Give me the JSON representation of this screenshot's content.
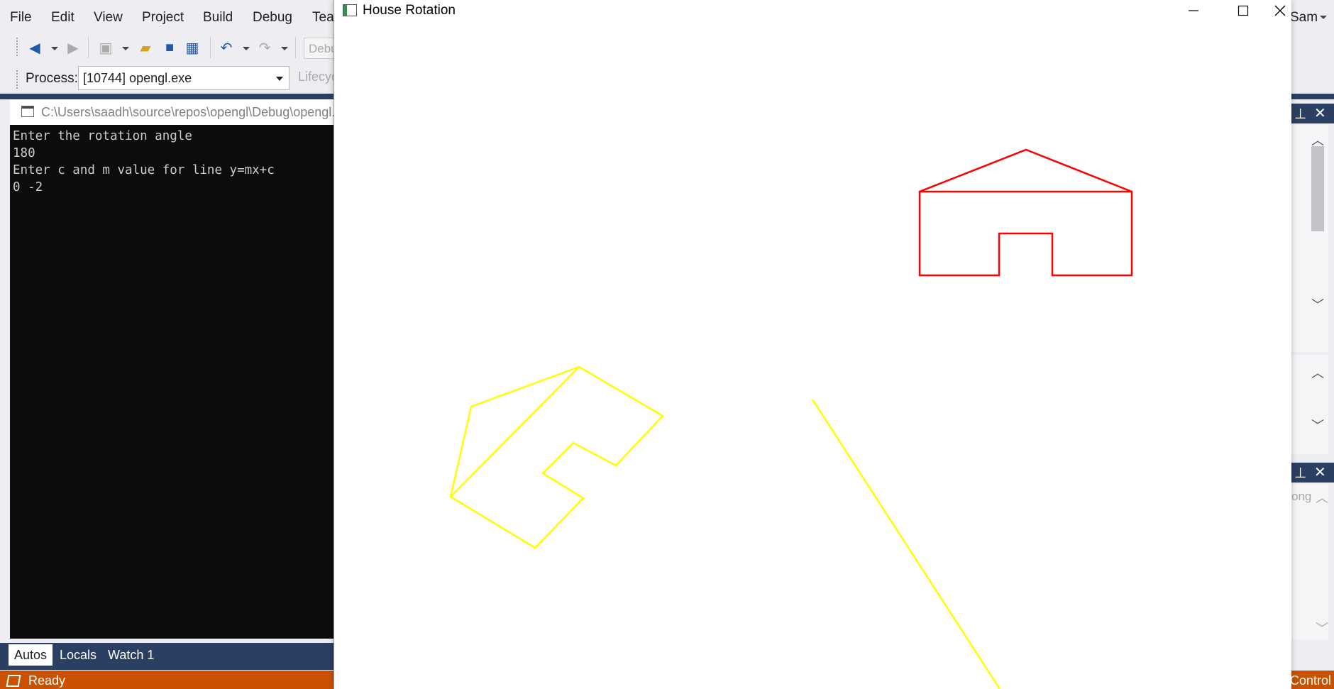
{
  "vs": {
    "menu": [
      "File",
      "Edit",
      "View",
      "Project",
      "Build",
      "Debug",
      "Team"
    ],
    "menu_right": "Sam",
    "config_placeholder": "Debug",
    "process_label": "Process:",
    "process_value": "[10744] opengl.exe",
    "lifecycle_label": "Lifecycle Events",
    "bottom_tabs": [
      "Autos",
      "Locals",
      "Watch 1"
    ],
    "status_ready": "Ready",
    "status_right": "Control",
    "right_panel_text": "ong",
    "colors": {
      "status": "#ca5100",
      "dark_band": "#2b3f63",
      "accent": "#1e5aa8"
    }
  },
  "console": {
    "title": "C:\\Users\\saadh\\source\\repos\\opengl\\Debug\\opengl.exe",
    "lines": [
      "Enter the rotation angle",
      "180",
      "Enter c and m value for line y=mx+c",
      "0 -2"
    ]
  },
  "house_window": {
    "title": "House Rotation",
    "colors": {
      "original_house": "#ff0000",
      "reflected_house": "#ffff00",
      "line": "#ffff00",
      "background": "#ffffff"
    },
    "inputs": {
      "rotation_angle": 180,
      "c": 0,
      "m": -2
    }
  }
}
